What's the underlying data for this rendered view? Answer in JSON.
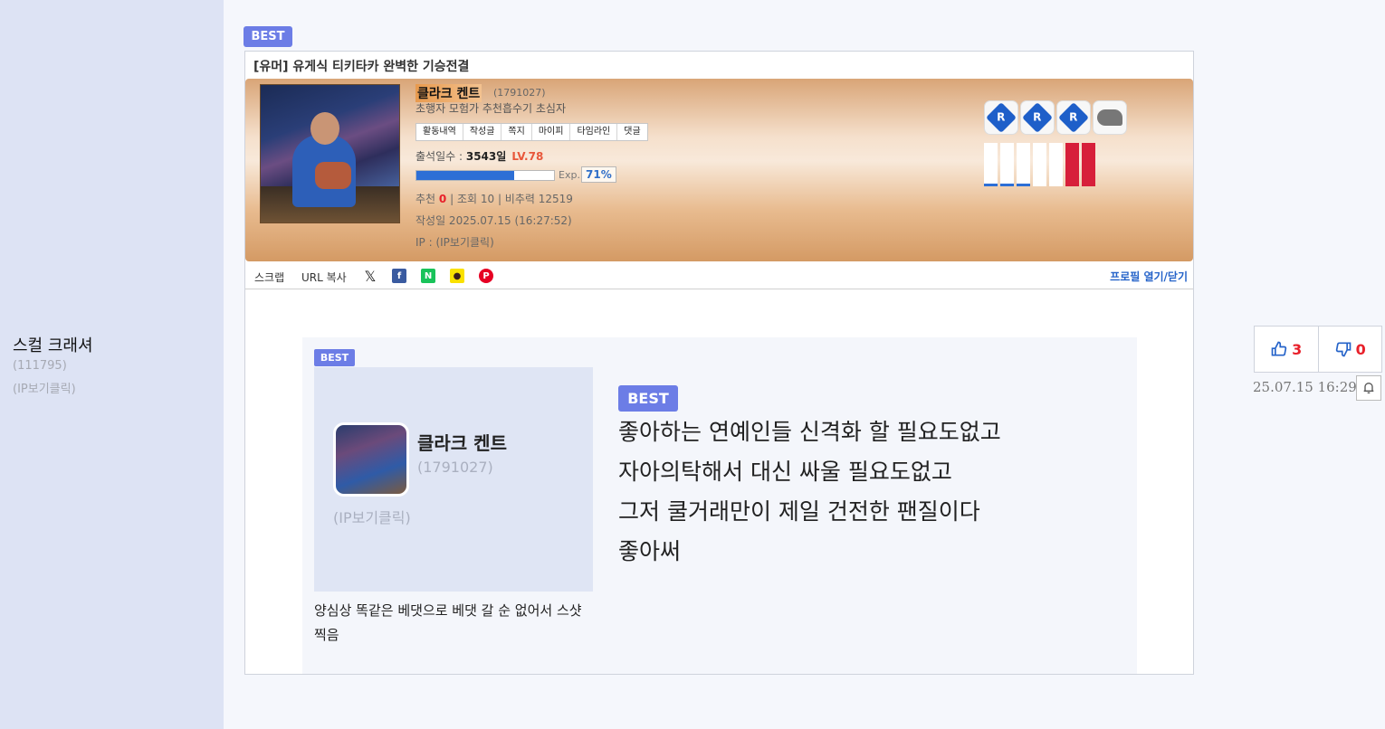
{
  "author": {
    "name": "스컬 크래셔",
    "id": "(111795)",
    "ip": "(IP보기클릭)"
  },
  "best_label": "BEST",
  "post": {
    "title": "[유머] 유게식 티키타카 완벽한 기승전결",
    "profile": {
      "nick": "클라크 켄트",
      "id": "(1791027)",
      "rank": "초행자 모험가 추천흡수기 초심자",
      "buttons": [
        "활동내역",
        "작성글",
        "쪽지",
        "마이피",
        "타임라인",
        "댓글"
      ],
      "attend_label": "출석일수 :",
      "attend_value": "3543일",
      "level": "LV.78",
      "exp_label": "Exp.",
      "exp_pct": "71%",
      "exp_fraction": 0.71,
      "stats": {
        "rec_label": "추천",
        "rec_value": "0",
        "views": "조회 10",
        "nonrec": "비추력 12519"
      },
      "date": "작성일 2025.07.15 (16:27:52)",
      "ip": "IP : (IP보기클릭)"
    },
    "share": {
      "scrap": "스크랩",
      "url_copy": "URL 복사",
      "profile_toggle": "프로필 열기/닫기"
    },
    "image": {
      "best": "BEST",
      "nick": "클라크 켄트",
      "id": "(1791027)",
      "ip": "(IP보기클릭)",
      "caption": "양심상 똑같은 베댓으로 베댓 갈 순 없어서 스샷 찍음",
      "big_best": "BEST",
      "lines": [
        "좋아하는 연예인들 신격화 할 필요도없고",
        "자아의탁해서 대신 싸울 필요도없고",
        "그저 쿨거래만이 제일 건전한 팬질이다",
        "좋아써"
      ]
    }
  },
  "vote": {
    "up": "3",
    "down": "0",
    "time": "25.07.15 16:29"
  }
}
